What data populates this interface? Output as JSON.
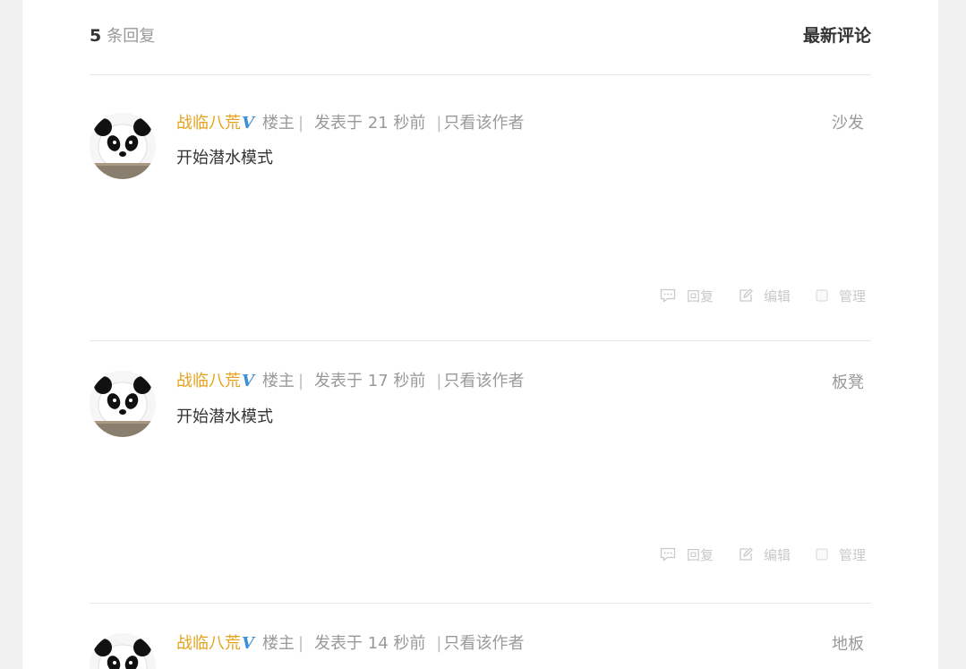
{
  "header": {
    "count": "5",
    "count_unit": "条回复",
    "sort_label": "最新评论"
  },
  "posts": [
    {
      "author": "战临八荒",
      "badge": "V",
      "role": "楼主",
      "time": "发表于 21 秒前",
      "only_author": "只看该作者",
      "floor": "沙发",
      "content": "开始潜水模式",
      "actions": {
        "reply": "回复",
        "edit": "编辑",
        "manage": "管理"
      }
    },
    {
      "author": "战临八荒",
      "badge": "V",
      "role": "楼主",
      "time": "发表于 17 秒前",
      "only_author": "只看该作者",
      "floor": "板凳",
      "content": "开始潜水模式",
      "actions": {
        "reply": "回复",
        "edit": "编辑",
        "manage": "管理"
      }
    },
    {
      "author": "战临八荒",
      "badge": "V",
      "role": "楼主",
      "time": "发表于 14 秒前",
      "only_author": "只看该作者",
      "floor": "地板"
    }
  ],
  "icons": {
    "reply": "comment-icon",
    "edit": "edit-icon",
    "manage": "checkbox-icon",
    "avatar": "panda-avatar"
  },
  "colors": {
    "author": "#e5a21c",
    "badge": "#3b8fd9",
    "muted": "#999999",
    "action": "#c9c9c9"
  }
}
